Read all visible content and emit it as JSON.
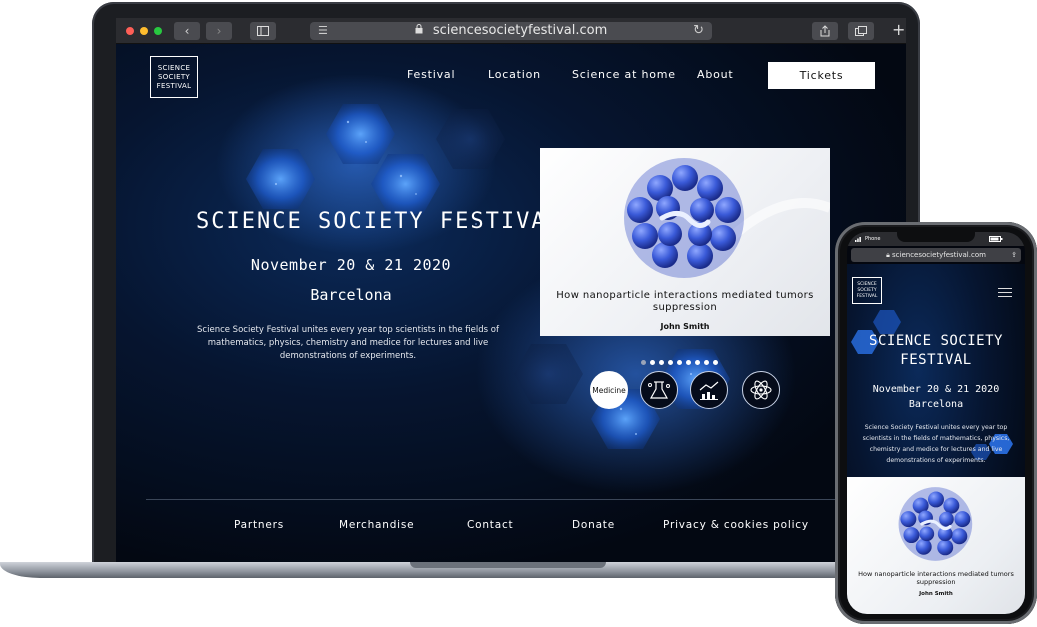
{
  "laptop": {
    "browser": {
      "url": "sciencesocietyfestival.com",
      "back_glyph": "‹",
      "forward_glyph": "›",
      "plus_glyph": "+"
    },
    "logo": [
      "SCIENCE",
      "SOCIETY",
      "FESTIVAL"
    ],
    "nav": {
      "festival": "Festival",
      "location": "Location",
      "science_at_home": "Science at home",
      "about": "About",
      "tickets": "Tickets"
    },
    "hero": {
      "title": "SCIENCE SOCIETY FESTIVAL",
      "dates": "November 20 & 21 2020",
      "city": "Barcelona",
      "description": "Science Society Festival unites every year top scientists in the fields of mathematics, physics, chemistry and medice for lectures and live demonstrations of experiments."
    },
    "featured": {
      "title": "How nanoparticle interactions mediated tumors suppression",
      "author": "John Smith"
    },
    "pager": {
      "count": 9,
      "active_index": 0
    },
    "categories": [
      {
        "label": "Medicine",
        "icon": "medicine-text",
        "active": true
      },
      {
        "label": "",
        "icon": "chemistry-flask-icon",
        "active": false
      },
      {
        "label": "",
        "icon": "math-chart-icon",
        "active": false
      },
      {
        "label": "",
        "icon": "physics-atom-icon",
        "active": false
      }
    ],
    "footer": {
      "partners": "Partners",
      "merchandise": "Merchandise",
      "contact": "Contact",
      "donate": "Donate",
      "privacy": "Privacy & cookies policy"
    }
  },
  "phone": {
    "status_carrier": "Phone",
    "url": "sciencesocietyfestival.com",
    "logo": [
      "SCIENCE",
      "SOCIETY",
      "FESTIVAL"
    ],
    "hero": {
      "title_line1": "SCIENCE SOCIETY",
      "title_line2": "FESTIVAL",
      "dates": "November 20 & 21 2020",
      "city": "Barcelona",
      "description": "Science Society Festival unites every year top scientists in the fields of mathematics, physics, chemistry and medice for lectures and live demonstrations of experiments."
    },
    "featured": {
      "title": "How nanoparticle interactions mediated tumors suppression",
      "author": "John Smith"
    }
  },
  "colors": {
    "background_dark": "#04070f",
    "hex_glow": "#2f7dff",
    "molecule_blue": "#3a5ad8",
    "accent_white": "#ffffff"
  }
}
